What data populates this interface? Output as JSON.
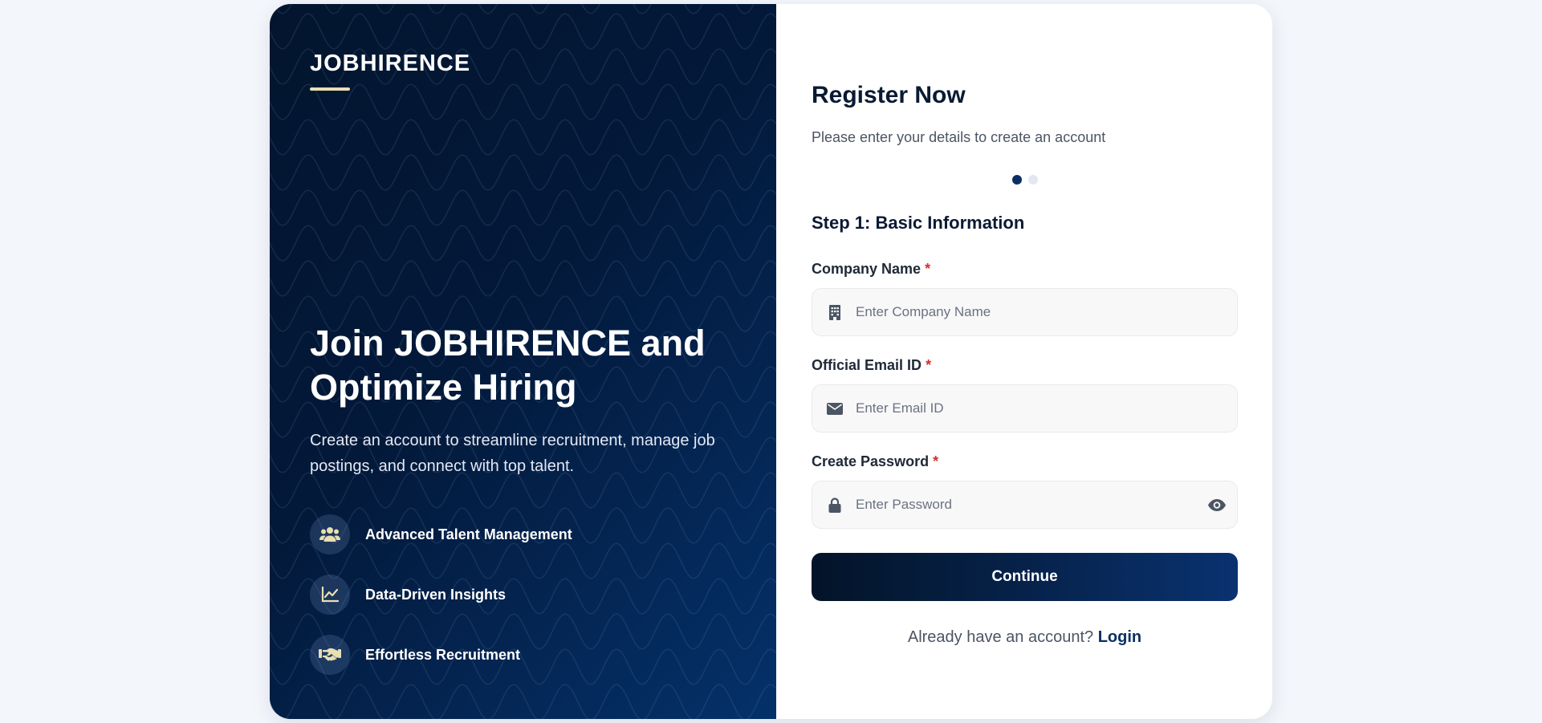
{
  "brand": {
    "name": "JOBHIRENCE",
    "accent": "#e8dfb2"
  },
  "hero": {
    "title": "Join JOBHIRENCE and Optimize Hiring",
    "description": "Create an account to streamline recruitment, manage job postings, and connect with top talent."
  },
  "features": [
    {
      "icon": "users-icon",
      "label": "Advanced Talent Management"
    },
    {
      "icon": "chart-line-icon",
      "label": "Data-Driven Insights"
    },
    {
      "icon": "handshake-icon",
      "label": "Effortless Recruitment"
    }
  ],
  "form": {
    "title": "Register Now",
    "subtitle": "Please enter your details to create an account",
    "steps": {
      "total": 2,
      "current": 1
    },
    "step_title": "Step 1: Basic Information",
    "required_marker": "*",
    "fields": {
      "company": {
        "label": "Company Name",
        "placeholder": "Enter Company Name",
        "icon": "building-icon",
        "value": ""
      },
      "email": {
        "label": "Official Email ID",
        "placeholder": "Enter Email ID",
        "icon": "envelope-icon",
        "value": ""
      },
      "password": {
        "label": "Create Password",
        "placeholder": "Enter Password",
        "icon": "lock-icon",
        "toggle_icon": "eye-icon",
        "value": ""
      }
    },
    "continue_label": "Continue",
    "login_prompt": "Already have an account?",
    "login_link": "Login"
  },
  "colors": {
    "panel_dark": "#03152e",
    "panel_blue": "#04316a",
    "primary": "#0b2f63",
    "required": "#d32f2f",
    "page_bg": "#f3f6fb"
  }
}
